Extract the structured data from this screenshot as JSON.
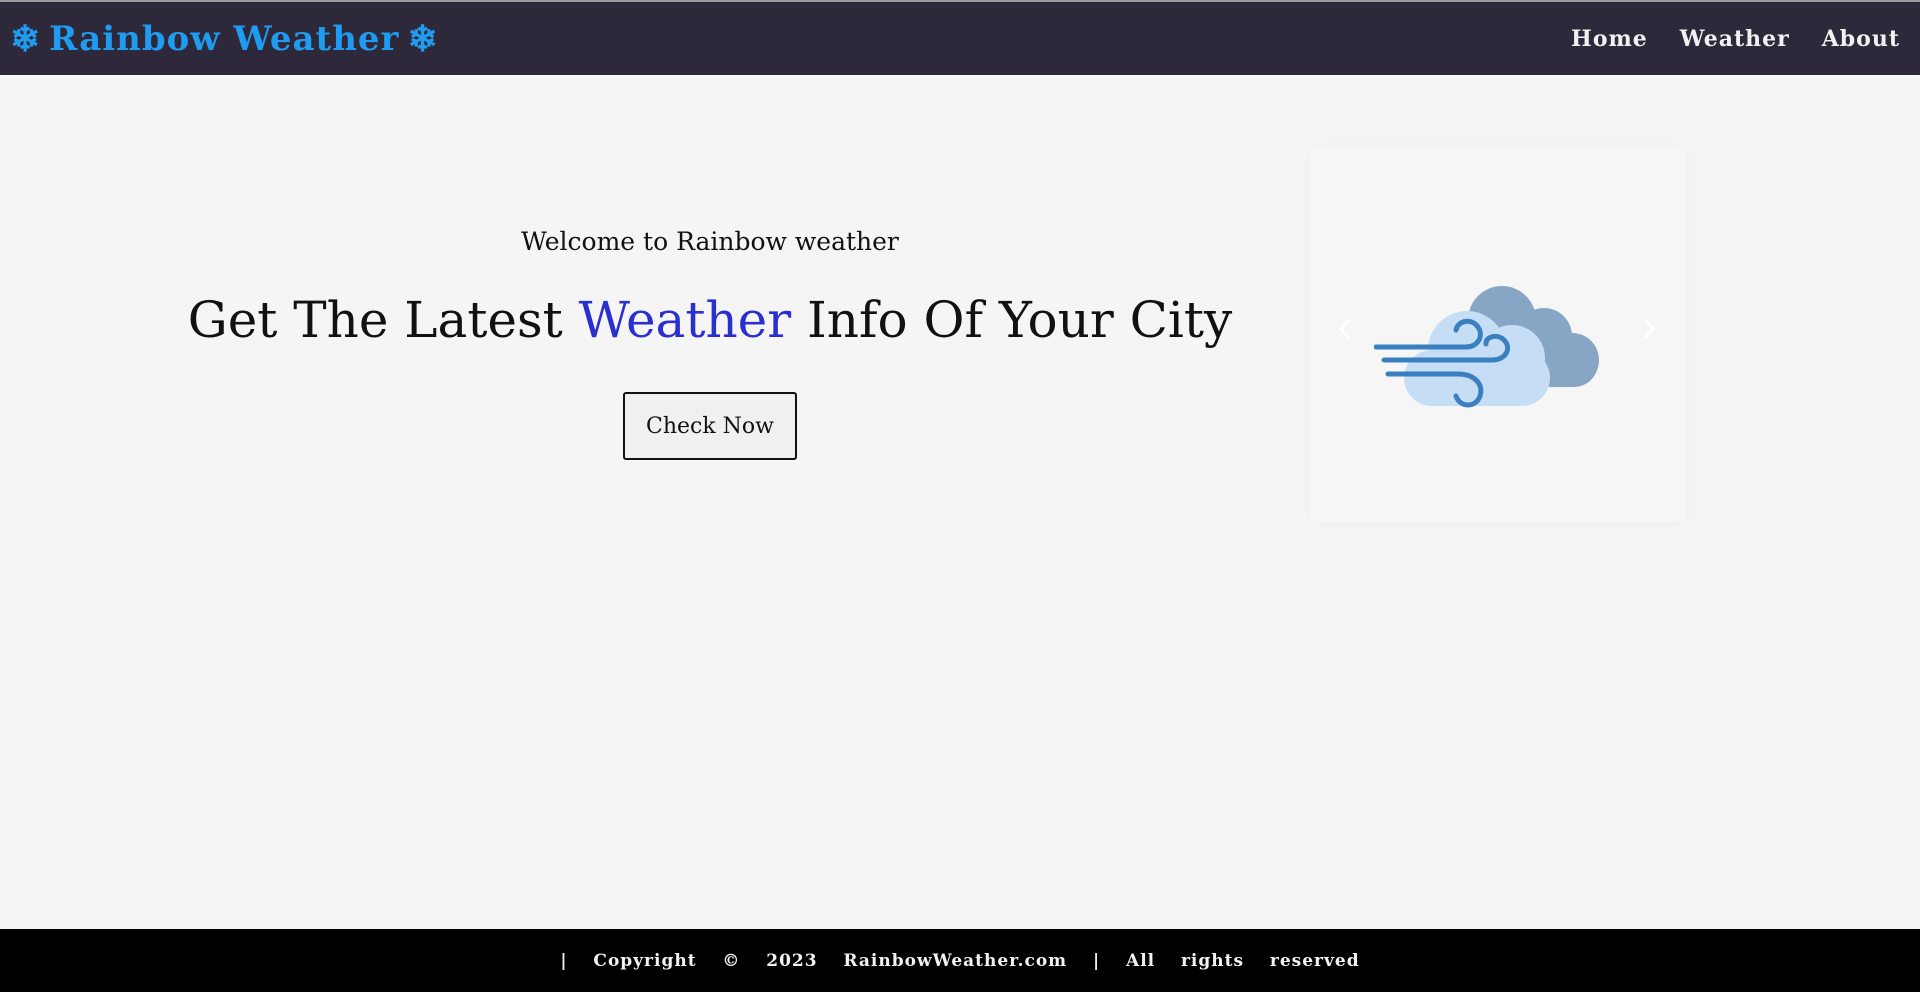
{
  "brand": {
    "icon_left": "❄",
    "name": "Rainbow Weather",
    "icon_right": "❄",
    "color": "#1f9bf0"
  },
  "nav": {
    "items": [
      {
        "label": "Home"
      },
      {
        "label": "Weather"
      },
      {
        "label": "About"
      }
    ]
  },
  "hero": {
    "welcome": "Welcome to Rainbow weather",
    "headline_prefix": "Get The Latest ",
    "headline_accent": "Weather",
    "headline_suffix": " Info Of Your City",
    "accent_color": "#2a2fd0",
    "cta_label": "Check Now"
  },
  "carousel": {
    "image_icon": "wind-cloud-icon",
    "prev_icon": "chevron-left-icon",
    "next_icon": "chevron-right-icon"
  },
  "footer": {
    "text": "|  Copyright  ©  2023  RainbowWeather.com  |  All  rights  reserved"
  },
  "colors": {
    "navbar_bg": "#2e293a",
    "page_bg": "#f6f5f5",
    "footer_bg": "#000000"
  }
}
